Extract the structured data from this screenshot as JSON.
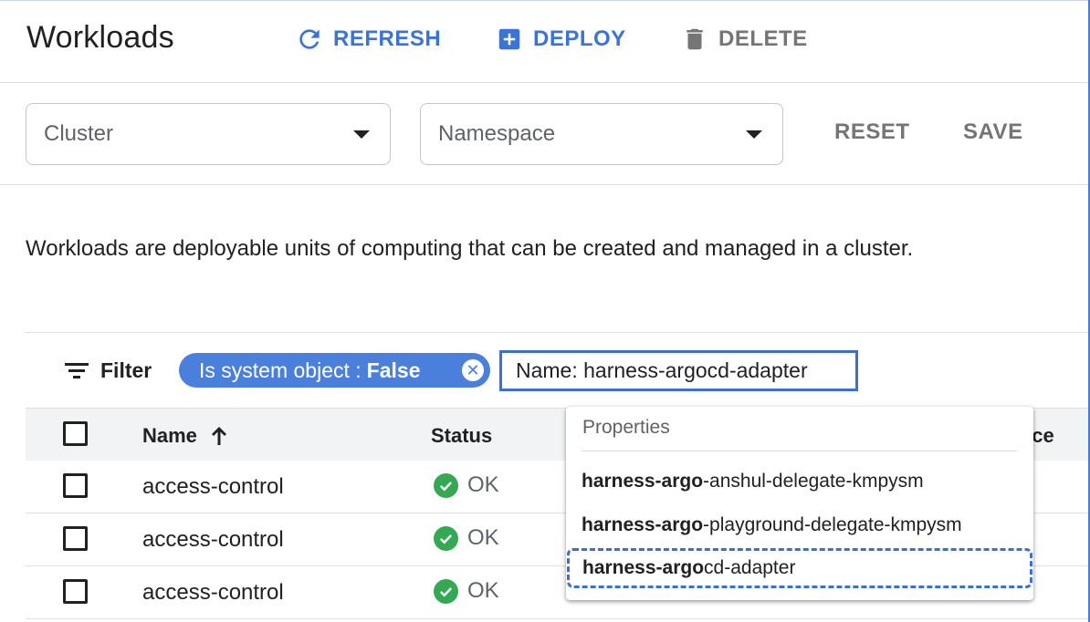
{
  "header": {
    "title": "Workloads",
    "refresh_label": "REFRESH",
    "deploy_label": "DEPLOY",
    "delete_label": "DELETE"
  },
  "filters": {
    "cluster_placeholder": "Cluster",
    "namespace_placeholder": "Namespace",
    "reset_label": "RESET",
    "save_label": "SAVE"
  },
  "description": "Workloads are deployable units of computing that can be created and managed in a cluster.",
  "filter_row": {
    "filter_label": "Filter",
    "chip_key": "Is system object :",
    "chip_value": "False",
    "input_value": "Name: harness-argocd-adapter"
  },
  "table": {
    "columns": {
      "name": "Name",
      "status": "Status",
      "namespace_partial": "ace"
    },
    "rows": [
      {
        "name": "access-control",
        "status": "OK"
      },
      {
        "name": "access-control",
        "status": "OK"
      },
      {
        "name": "access-control",
        "status": "OK"
      }
    ]
  },
  "dropdown": {
    "header": "Properties",
    "items": [
      {
        "match": "harness-argo",
        "rest": "-anshul-delegate-kmpysm"
      },
      {
        "match": "harness-argo",
        "rest": "-playground-delegate-kmpysm"
      },
      {
        "match": "harness-argo",
        "rest": "cd-adapter"
      }
    ]
  },
  "colors": {
    "accent": "#3b74d6",
    "chip": "#4a7fdc",
    "ok": "#34a853",
    "disabled": "#757575"
  }
}
